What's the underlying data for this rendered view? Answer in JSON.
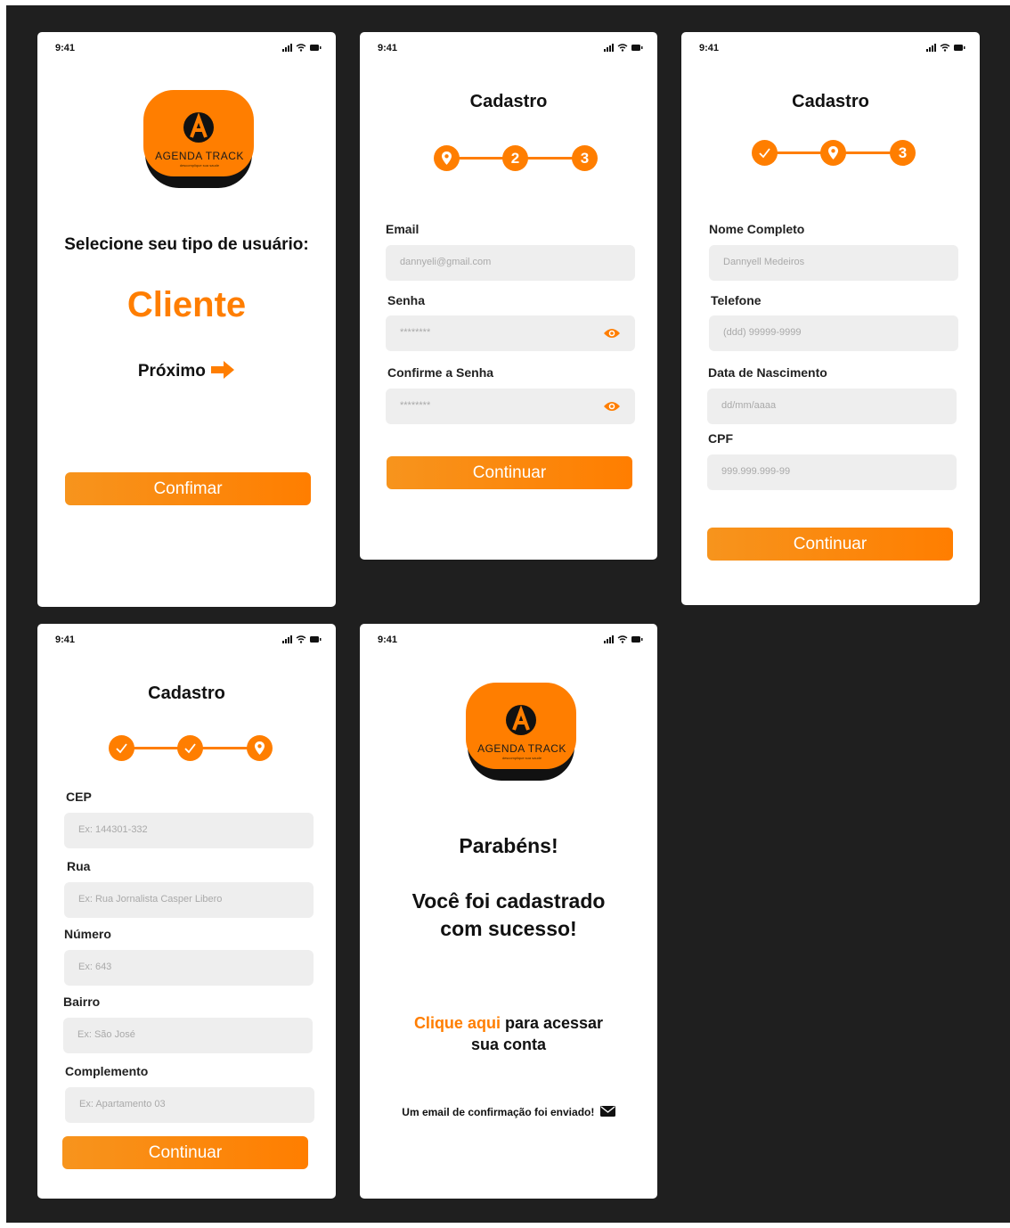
{
  "status_time": "9:41",
  "colors": {
    "accent": "#ff7e00",
    "background": "#1f1f1f",
    "field": "#eeeeee"
  },
  "screen1": {
    "logo_text": "AGENDA TRACK",
    "logo_tagline": "descomplique sua saude",
    "heading": "Selecione seu tipo de usuário:",
    "user_type": "Cliente",
    "next_label": "Próximo",
    "confirm_label": "Confimar"
  },
  "screen2": {
    "title": "Cadastro",
    "steps": [
      "",
      "2",
      "3"
    ],
    "email_label": "Email",
    "email_placeholder": "dannyeli@gmail.com",
    "password_label": "Senha",
    "password_placeholder": "********",
    "confirm_password_label": "Confirme a Senha",
    "confirm_password_placeholder": "********",
    "button": "Continuar"
  },
  "screen3": {
    "title": "Cadastro",
    "steps": [
      "",
      "",
      "3"
    ],
    "name_label": "Nome Completo",
    "name_placeholder": "Dannyell Medeiros",
    "phone_label": "Telefone",
    "phone_placeholder": "(ddd) 99999-9999",
    "birth_label": "Data de Nascimento",
    "birth_placeholder": "dd/mm/aaaa",
    "cpf_label": "CPF",
    "cpf_placeholder": "999.999.999-99",
    "button": "Continuar"
  },
  "screen4": {
    "title": "Cadastro",
    "cep_label": "CEP",
    "cep_placeholder": "Ex: 144301-332",
    "street_label": "Rua",
    "street_placeholder": "Ex: Rua Jornalista Casper Libero",
    "number_label": "Número",
    "number_placeholder": "Ex: 643",
    "district_label": "Bairro",
    "district_placeholder": "Ex: São José",
    "complement_label": "Complemento",
    "complement_placeholder": "Ex: Apartamento 03",
    "button": "Continuar"
  },
  "screen5": {
    "logo_text": "AGENDA TRACK",
    "logo_tagline": "descomplique sua saude",
    "congrats": "Parabéns!",
    "success_line1": "Você foi cadastrado",
    "success_line2": "com sucesso!",
    "link_text": "Clique aqui",
    "access_text": " para acessar",
    "access_line2": "sua conta",
    "email_notice": "Um email de confirmação foi enviado!"
  }
}
